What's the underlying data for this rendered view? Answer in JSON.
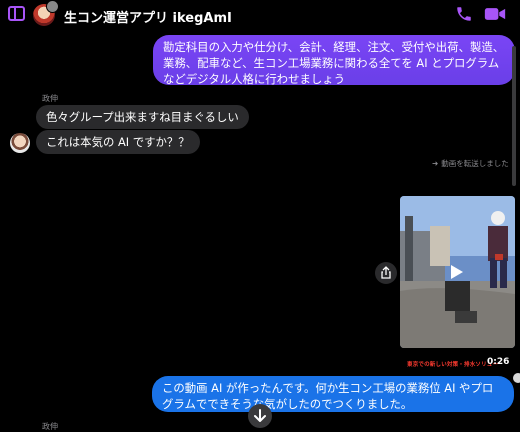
{
  "header": {
    "title": "生コン運営アプリ ikegAmI",
    "accent_color": "#a855f7",
    "icons": [
      "sidebar-toggle-icon",
      "group-avatar",
      "phone-icon",
      "video-camera-icon"
    ]
  },
  "messages": {
    "out1": "勘定科目の入力や仕分け、会計、経理、注文、受付や出荷、製造、業務、配車など、生コン工場業務に関わる全てを AI とプログラムなどデジタル人格に行わせましょう",
    "sender1": "政伸",
    "in1": "色々グループ出来ますね目まぐるしい",
    "in2": "これは本気の AI ですか？？",
    "forwarded": "動画を転送しました",
    "video_caption": "東京での新しい対策・排水ソリュー",
    "video_duration": "0:26",
    "out2": "この動画 AI が作ったんです。何か生コン工場の業務位 AI やプログラムでできそうな気がしたのでつくりました。",
    "sender2": "政伸"
  },
  "colors": {
    "outgoing_bubble": "#6d3ff0",
    "outgoing_bubble_blue": "#1a73e8",
    "incoming_bubble": "#2a2a2c"
  }
}
